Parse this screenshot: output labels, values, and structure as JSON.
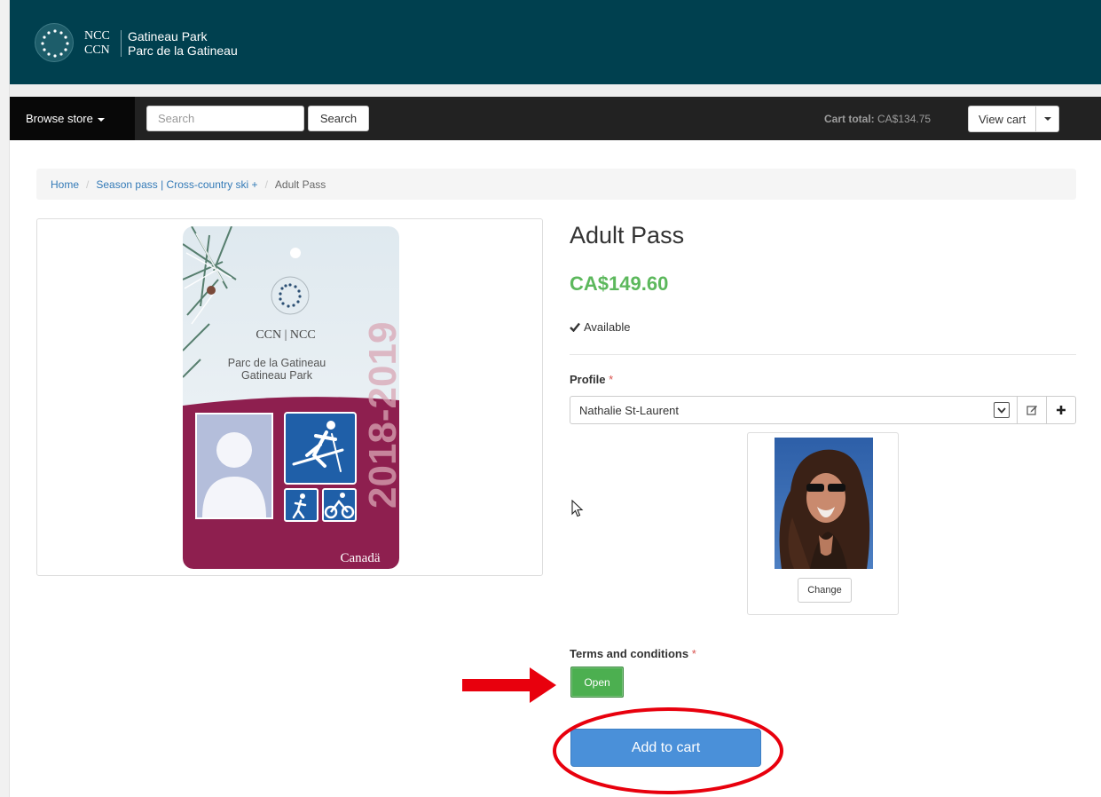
{
  "header": {
    "brand_ncc": "NCC",
    "brand_ccn": "CCN",
    "park_en": "Gatineau Park",
    "park_fr": "Parc de la Gatineau"
  },
  "nav": {
    "browse_label": "Browse store",
    "search_placeholder": "Search",
    "search_button": "Search",
    "cart_total_label": "Cart total:",
    "cart_total_value": "CA$134.75",
    "view_cart_label": "View cart"
  },
  "breadcrumb": {
    "home": "Home",
    "category": "Season pass | Cross-country ski +",
    "current": "Adult Pass"
  },
  "pass_card": {
    "org": "CCN | NCC",
    "park_fr": "Parc de la Gatineau",
    "park_en": "Gatineau Park",
    "season": "2018-2019",
    "wordmark": "Canadä"
  },
  "product": {
    "title": "Adult Pass",
    "price": "CA$149.60",
    "availability": "Available"
  },
  "profile": {
    "label": "Profile",
    "selected": "Nathalie St-Laurent",
    "change_button": "Change"
  },
  "terms": {
    "label": "Terms and conditions",
    "open_button": "Open"
  },
  "actions": {
    "add_to_cart": "Add to cart"
  },
  "colors": {
    "header_bg": "#00404f",
    "navbar_bg": "#222222",
    "price_green": "#5cb85c",
    "open_green": "#4caf50",
    "primary_blue": "#4a90d9",
    "annotation_red": "#e8000d",
    "card_maroon": "#8e1f4f"
  },
  "required_marker": "*"
}
